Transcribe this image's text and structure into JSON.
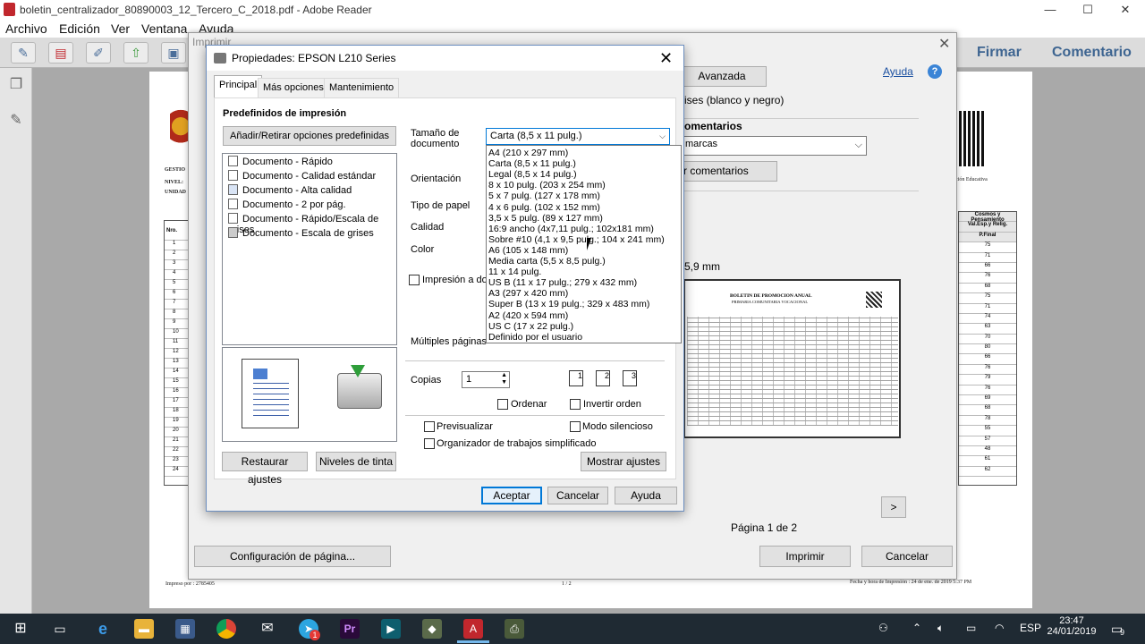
{
  "window": {
    "title": "boletin_centralizador_80890003_12_Tercero_C_2018.pdf - Adobe Reader",
    "controls": {
      "minimize": "—",
      "maximize": "☐",
      "close": "✕"
    }
  },
  "menubar": [
    "Archivo",
    "Edición",
    "Ver",
    "Ventana",
    "Ayuda"
  ],
  "toolbar_right": {
    "firmar": "Firmar",
    "comentario": "Comentario"
  },
  "pdf_page": {
    "footer_left": "Impreso por : 2785405",
    "footer_center": "1  /  2",
    "footer_right": "Fecha y hora de Impresión : 24 de ene. de 2019 5:37 PM",
    "left_labels": [
      "GESTIO",
      "NIVEL:",
      "UNIDAD"
    ],
    "left_header": "Nro.",
    "row_numbers": [
      "1",
      "2",
      "3",
      "4",
      "5",
      "6",
      "7",
      "8",
      "9",
      "10",
      "11",
      "12",
      "13",
      "14",
      "15",
      "16",
      "17",
      "18",
      "19",
      "20",
      "21",
      "22",
      "23",
      "24"
    ],
    "right_header_1": "Cosmos y Pensamiento",
    "right_header_2": "Val.Esp.y Relig.",
    "right_header_3": "P.Final",
    "right_values": [
      "75",
      "71",
      "66",
      "76",
      "68",
      "75",
      "71",
      "74",
      "63",
      "70",
      "80",
      "66",
      "76",
      "79",
      "76",
      "69",
      "68",
      "78",
      "55",
      "57",
      "48",
      "61",
      "62"
    ],
    "right_caption": "ción Educativa"
  },
  "print_dialog": {
    "title": "Imprimir",
    "close": "✕",
    "avanzada": "Avanzada",
    "ayuda": "Ayuda",
    "help_icon": "?",
    "grises_text": "ises (blanco y negro)",
    "comentarios_heading": "omentarios",
    "marcas_value": "marcas",
    "comentarios_button": "r comentarios",
    "size_text": "5,9 mm",
    "preview_title": "BOLETIN DE PROMOCION ANUAL",
    "preview_subtitle": "PRIMARIA COMUNITARIA VOCACIONAL",
    "next_page": ">",
    "page_indicator": "Página 1 de 2",
    "config_button": "Configuración de página...",
    "print_button": "Imprimir",
    "cancel_button": "Cancelar"
  },
  "props_dialog": {
    "title": "Propiedades: EPSON L210 Series",
    "close": "✕",
    "tabs": [
      "Principal",
      "Más opciones",
      "Mantenimiento"
    ],
    "presets_heading": "Predefinidos de impresión",
    "presets_button": "Añadir/Retirar opciones predefinidas",
    "presets": [
      "Documento - Rápido",
      "Documento - Calidad estándar",
      "Documento - Alta calidad",
      "Documento - 2 por pág.",
      "Documento - Rápido/Escala de grises",
      "Documento - Escala de grises"
    ],
    "labels": {
      "tamano": "Tamaño de documento",
      "orientacion": "Orientación",
      "tipo_papel": "Tipo de papel",
      "calidad": "Calidad",
      "color": "Color",
      "impresion_doble": "Impresión a dob",
      "multiples": "Múltiples páginas",
      "copias": "Copias",
      "ordenar": "Ordenar",
      "invertir": "Invertir orden",
      "previsualizar": "Previsualizar",
      "silencioso": "Modo silencioso",
      "organizador": "Organizador de trabajos simplificado"
    },
    "tamano_value": "Carta (8,5 x 11 pulg.)",
    "copias_value": "1",
    "paper_sizes": [
      "A4 (210 x 297 mm)",
      "Carta (8,5 x 11 pulg.)",
      "Legal (8,5 x 14 pulg.)",
      "8 x 10 pulg. (203 x 254 mm)",
      "5 x 7 pulg. (127 x 178 mm)",
      "4 x 6 pulg. (102 x 152 mm)",
      "3,5 x 5 pulg. (89 x 127 mm)",
      "16:9 ancho (4x7,11 pulg.; 102x181 mm)",
      "Sobre #10 (4,1 x 9,5 pulg.; 104 x 241 mm)",
      "A6 (105 x 148 mm)",
      "Media carta (5,5 x 8,5 pulg.)",
      "11 x 14 pulg.",
      "US B (11 x 17 pulg.; 279 x 432 mm)",
      "A3 (297 x 420 mm)",
      "Super B (13 x 19 pulg.; 329 x 483 mm)",
      "A2 (420 x 594 mm)",
      "US C (17 x 22 pulg.)",
      "Definido por el usuario"
    ],
    "buttons": {
      "restaurar": "Restaurar ajustes",
      "niveles": "Niveles de tinta",
      "mostrar": "Mostrar ajustes",
      "aceptar": "Aceptar",
      "cancelar": "Cancelar",
      "ayuda": "Ayuda"
    }
  },
  "taskbar": {
    "language": "ESP",
    "time": "23:47",
    "date": "24/01/2019",
    "notifications": "9",
    "telegram_badge": "1"
  },
  "colors": {
    "accent": "#0078d7",
    "adobe_blue": "#3e6591",
    "taskbar": "#1f2a33"
  }
}
